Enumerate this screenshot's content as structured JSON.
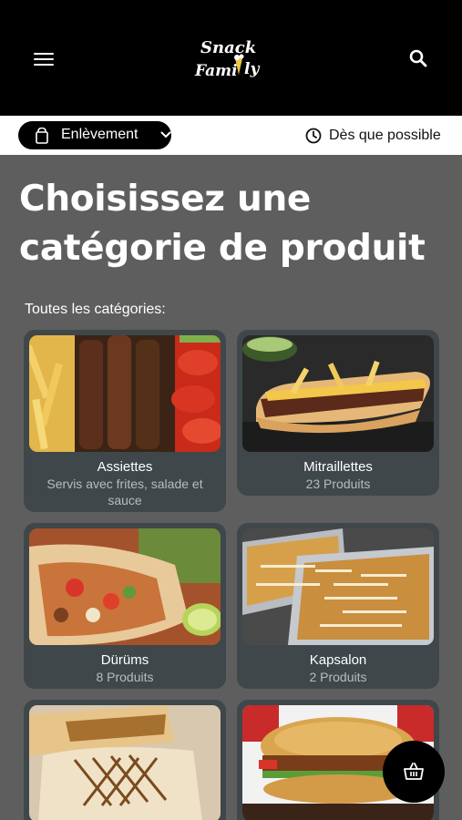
{
  "header": {
    "logo_line1": "Snack",
    "logo_line2": "Fami",
    "logo_line2_end": "ly"
  },
  "order": {
    "mode_label": "Enlèvement",
    "time_label": "Dès que possible"
  },
  "main": {
    "title": "Choisissez une catégorie de produit",
    "section_label": "Toutes les catégories:"
  },
  "categories": [
    {
      "name": "Assiettes",
      "subtitle": "Servis avec frites, salade et sauce"
    },
    {
      "name": "Mitraillettes",
      "subtitle": "23 Produits"
    },
    {
      "name": "Dürüms",
      "subtitle": "8 Produits"
    },
    {
      "name": "Kapsalon",
      "subtitle": "2 Produits"
    },
    {
      "name": "",
      "subtitle": ""
    },
    {
      "name": "",
      "subtitle": ""
    }
  ],
  "icons": {
    "menu": "hamburger-icon",
    "search": "search-icon",
    "bag": "shopping-bag-icon",
    "chevron": "chevron-down-icon",
    "clock": "clock-icon",
    "cart": "basket-icon"
  }
}
